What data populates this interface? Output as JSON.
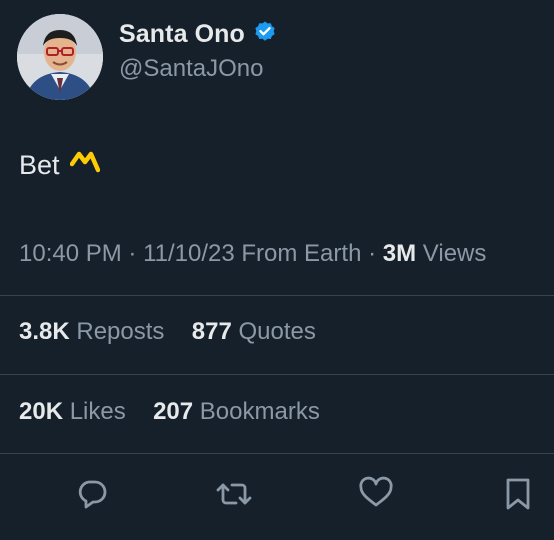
{
  "user": {
    "display_name": "Santa Ono",
    "handle": "@SantaJOno",
    "verified_icon": "verified-badge-icon"
  },
  "tweet": {
    "text": "Bet",
    "emoji_icon": "wolverine-claw-emoji-icon",
    "time": "10:40 PM",
    "date": "11/10/23",
    "source": "From Earth",
    "views_count": "3M",
    "views_label": "Views"
  },
  "stats": {
    "reposts_count": "3.8K",
    "reposts_label": "Reposts",
    "quotes_count": "877",
    "quotes_label": "Quotes",
    "likes_count": "20K",
    "likes_label": "Likes",
    "bookmarks_count": "207",
    "bookmarks_label": "Bookmarks"
  },
  "actions": [
    "reply-icon",
    "repost-icon",
    "like-icon",
    "bookmark-icon"
  ],
  "colors": {
    "background": "#15202b",
    "text_primary": "#e7e9ea",
    "text_secondary": "#8b98a5",
    "divider": "#38444d",
    "verified": "#1d9bf0",
    "emoji": "#ffcb05"
  }
}
